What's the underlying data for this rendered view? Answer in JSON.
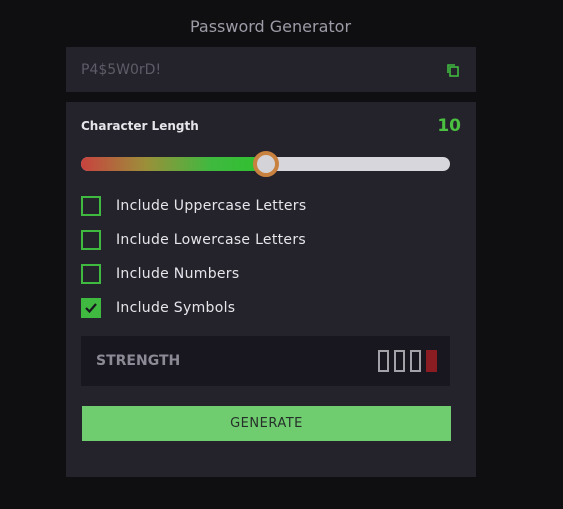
{
  "app": {
    "title": "Password Generator"
  },
  "output": {
    "password": "P4$5W0rD!",
    "copy_icon": "copy-icon"
  },
  "length": {
    "label": "Character Length",
    "value": "10",
    "slider_fraction": 0.5
  },
  "options": [
    {
      "label": "Include Uppercase Letters",
      "checked": false
    },
    {
      "label": "Include Lowercase Letters",
      "checked": false
    },
    {
      "label": "Include Numbers",
      "checked": false
    },
    {
      "label": "Include Symbols",
      "checked": true
    }
  ],
  "strength": {
    "label": "STRENGTH",
    "bars_total": 4,
    "bars_filled": 1,
    "level_color": "#8b1c22"
  },
  "generate": {
    "label": "GENERATE"
  },
  "colors": {
    "accent": "#4bbf3f",
    "button": "#6fcd6f",
    "panel": "#24232c",
    "background": "#0f0f12"
  }
}
